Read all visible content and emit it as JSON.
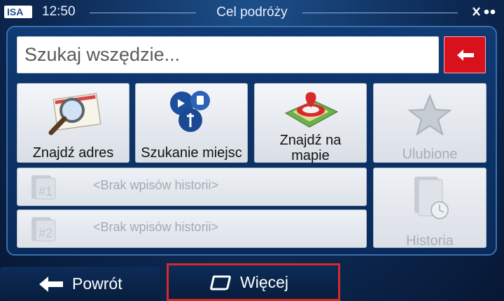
{
  "status": {
    "time": "12:50",
    "title": "Cel podróży"
  },
  "search": {
    "placeholder": "Szukaj wszędzie..."
  },
  "tiles": [
    {
      "label": "Znajdź adres",
      "icon": "envelope-magnifier-icon",
      "enabled": true
    },
    {
      "label": "Szukanie miejsc",
      "icon": "poi-pins-icon",
      "enabled": true
    },
    {
      "label_line1": "Znajdź na",
      "label_line2": "mapie",
      "icon": "map-pin-icon",
      "enabled": true
    },
    {
      "label": "Ulubione",
      "icon": "star-icon",
      "enabled": false
    }
  ],
  "history": [
    {
      "slot": "#1",
      "label": "<Brak wpisów historii>"
    },
    {
      "slot": "#2",
      "label": "<Brak wpisów historii>"
    }
  ],
  "history_button": {
    "label": "Historia",
    "icon": "folder-clock-icon"
  },
  "bottom": {
    "back_label": "Powrót",
    "more_label": "Więcej"
  },
  "colors": {
    "accent_red": "#d9111c",
    "panel_blue": "#0f3a73",
    "highlight": "#d42a2a"
  }
}
